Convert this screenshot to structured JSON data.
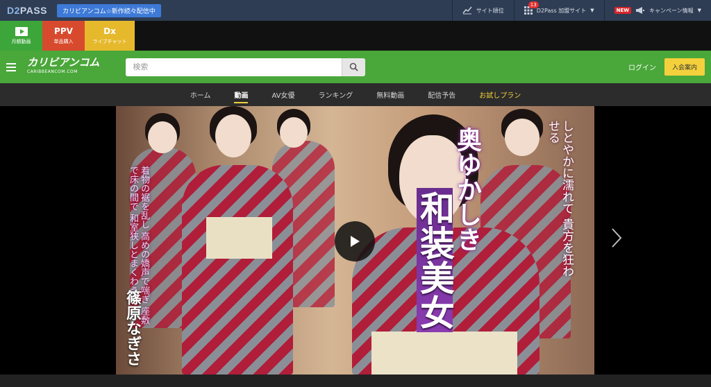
{
  "topbar": {
    "logo_main": "D2",
    "logo_tail": "PASS",
    "news_button": "カリビアンコム☆新作続々配信中",
    "site_rank": "サイト順位",
    "partner_badge": "13",
    "partner_sites": "D2Pass 加盟サイト",
    "new_tag": "NEW",
    "campaign": "キャンペーン情報",
    "caret": "▼"
  },
  "categories": [
    {
      "label": "月額動画",
      "big": ""
    },
    {
      "label": "単品購入",
      "big": "PPV"
    },
    {
      "label": "ライブチャット",
      "big": "Dx"
    }
  ],
  "header": {
    "logo_text": "カリビアンコム",
    "logo_sub": "CARIBBEANCOM.COM",
    "search_placeholder": "検索",
    "login": "ログイン",
    "join": "入会案内"
  },
  "nav": {
    "items": [
      "ホーム",
      "動画",
      "AV女優",
      "ランキング",
      "無料動画",
      "配信予告",
      "お試しプラン"
    ],
    "active": "動画"
  },
  "banner": {
    "tagline": "奥ゆかしき",
    "title": "和装美女",
    "actress": "篠原なぎさ",
    "copy_left": "着物の裾を乱し 高めの嬌声で喘ぎ 座敷で床の間で 和室狭しとまくわう！",
    "copy_right": "しとやかに濡れて 貴方を狂わせる"
  },
  "colors": {
    "topbar_bg": "#2e3d54",
    "green_bar": "#4aa73a",
    "accent_yellow": "#f4d13c",
    "ppv_red": "#d84a2e"
  },
  "icons": {
    "play": "play-icon",
    "search": "search-icon",
    "next": "chevron-right-icon",
    "menu": "hamburger-icon"
  }
}
